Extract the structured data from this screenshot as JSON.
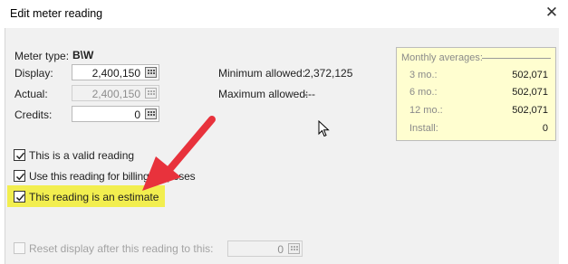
{
  "window": {
    "title": "Edit meter reading",
    "close_glyph": "✕"
  },
  "meter_type": {
    "label": "Meter type:",
    "value": "B\\W"
  },
  "display": {
    "label": "Display:",
    "value": "2,400,150"
  },
  "actual": {
    "label": "Actual:",
    "value": "2,400,150"
  },
  "credits": {
    "label": "Credits:",
    "value": "0"
  },
  "minimum": {
    "label": "Minimum allowed:",
    "value": "2,372,125"
  },
  "maximum": {
    "label": "Maximum allowed:",
    "value": "---"
  },
  "monthly_averages": {
    "title": "Monthly averages:",
    "rows": [
      {
        "label": "3 mo.:",
        "value": "502,071"
      },
      {
        "label": "6 mo.:",
        "value": "502,071"
      },
      {
        "label": "12 mo.:",
        "value": "502,071"
      },
      {
        "label": "Install:",
        "value": "0"
      }
    ]
  },
  "checkboxes": {
    "valid_reading": {
      "label": "This is a valid reading",
      "checked": true
    },
    "billing": {
      "label": "Use this reading for billing purposes",
      "checked": true
    },
    "estimate": {
      "label": "This reading is an estimate",
      "checked": true
    },
    "reset_display": {
      "label": "Reset display after this reading to this:",
      "checked": false,
      "value": "0"
    }
  },
  "colors": {
    "highlight": "#f2ee4f",
    "annotation_arrow": "#e8323c",
    "averages_background": "#fffed0"
  }
}
